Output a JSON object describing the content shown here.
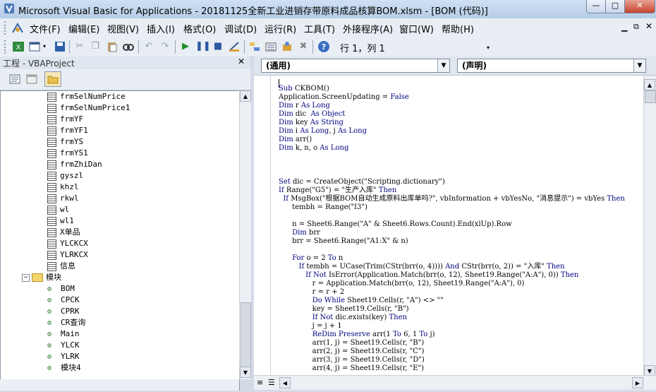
{
  "window": {
    "title": "Microsoft Visual Basic for Applications - 20181125全新工业进销存带原料成品核算BOM.xlsm - [BOM (代码)]",
    "controls": [
      "minimize",
      "maximize",
      "close"
    ]
  },
  "menubar": {
    "items": [
      {
        "label": "文件(F)"
      },
      {
        "label": "编辑(E)"
      },
      {
        "label": "视图(V)"
      },
      {
        "label": "插入(I)"
      },
      {
        "label": "格式(O)"
      },
      {
        "label": "调试(D)"
      },
      {
        "label": "运行(R)"
      },
      {
        "label": "工具(T)"
      },
      {
        "label": "外接程序(A)"
      },
      {
        "label": "窗口(W)"
      },
      {
        "label": "帮助(H)"
      }
    ]
  },
  "toolbar": {
    "cursor_position": "行 1，列 1",
    "icons": [
      "excel-icon",
      "insert-userform-icon",
      "save-icon",
      "cut-icon",
      "copy-icon",
      "paste-icon",
      "find-icon",
      "undo-icon",
      "redo-icon",
      "run-icon",
      "break-icon",
      "reset-icon",
      "design-mode-icon",
      "project-explorer-icon",
      "properties-icon",
      "object-browser-icon",
      "toolbox-icon",
      "help-icon"
    ]
  },
  "project_pane": {
    "title": "工程 - VBAProject",
    "forms": [
      "frmSelNumPrice",
      "frmSelNumPrice1",
      "frmYF",
      "frmYF1",
      "frmYS",
      "frmYS1",
      "frmZhiDan",
      "gyszl",
      "khzl",
      "rkwl",
      "wl",
      "wl1",
      "X单品",
      "YLCKCX",
      "YLRKCX",
      "信息"
    ],
    "modules_folder": "模块",
    "modules": [
      "BOM",
      "CPCK",
      "CPRK",
      "CR查询",
      "Main",
      "YLCK",
      "YLRK",
      "模块4"
    ]
  },
  "code_pane": {
    "object_combo": "(通用)",
    "procedure_combo": "(声明)",
    "lines": [
      "",
      "Sub CKBOM()",
      "Application.ScreenUpdating = False",
      "Dim r As Long",
      "Dim dic  As Object",
      "Dim key As String",
      "Dim i As Long, j As Long",
      "Dim arr()",
      "Dim k, n, o As Long",
      "",
      "",
      "",
      "Set dic = CreateObject(\"Scripting.dictionary\")",
      "If Range(\"G5\") = \"生产入库\" Then",
      "  If MsgBox(\"根据BOM自动生成原料出库单吗?\", vbInformation + vbYesNo, \"消息提示\") = vbYes Then",
      "      tembh = Range(\"I3\")",
      "",
      "      n = Sheet6.Range(\"A\" & Sheet6.Rows.Count).End(xlUp).Row",
      "      Dim brr",
      "      brr = Sheet6.Range(\"A1:X\" & n)",
      "",
      "      For o = 2 To n",
      "         If tembh = UCase(Trim(CStr(brr(o, 4)))) And CStr(brr(o, 2)) = \"入库\" Then",
      "            If Not IsError(Application.Match(brr(o, 12), Sheet19.Range(\"A:A\"), 0)) Then",
      "               r = Application.Match(brr(o, 12), Sheet19.Range(\"A:A\"), 0)",
      "               r = r + 2",
      "               Do While Sheet19.Cells(r, \"A\") <> \"\"",
      "               key = Sheet19.Cells(r, \"B\")",
      "               If Not dic.exists(key) Then",
      "               j = j + 1",
      "               ReDim Preserve arr(1 To 6, 1 To j)",
      "               arr(1, j) = Sheet19.Cells(r, \"B\")",
      "               arr(2, j) = Sheet19.Cells(r, \"C\")",
      "               arr(3, j) = Sheet19.Cells(r, \"D\")",
      "               arr(4, j) = Sheet19.Cells(r, \"E\")"
    ]
  }
}
